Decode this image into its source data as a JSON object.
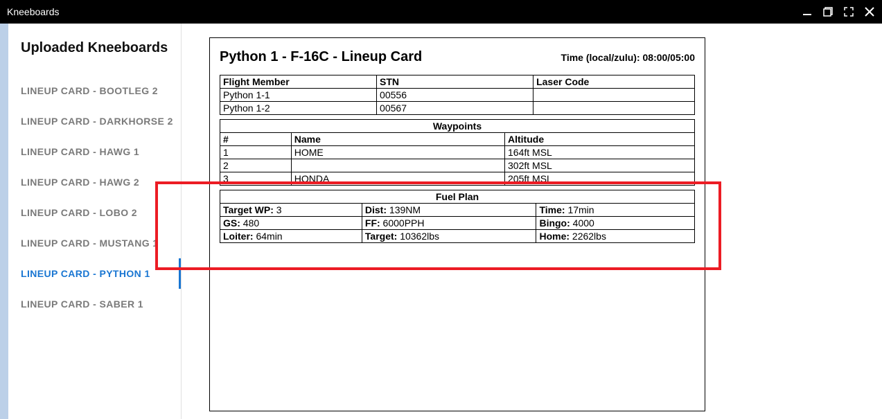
{
  "titlebar": {
    "title": "Kneeboards"
  },
  "sidebar": {
    "title": "Uploaded Kneeboards",
    "items": [
      {
        "label": "LINEUP CARD - BOOTLEG 2"
      },
      {
        "label": "LINEUP CARD - DARKHORSE 2"
      },
      {
        "label": "LINEUP CARD - HAWG 1"
      },
      {
        "label": "LINEUP CARD - HAWG 2"
      },
      {
        "label": "LINEUP CARD - LOBO 2"
      },
      {
        "label": "LINEUP CARD - MUSTANG 1"
      },
      {
        "label": "LINEUP CARD - PYTHON 1"
      },
      {
        "label": "LINEUP CARD - SABER 1"
      }
    ],
    "active_index": 6
  },
  "card": {
    "title": "Python 1 - F-16C - Lineup Card",
    "time_label": "Time (local/zulu): 08:00/05:00",
    "flight_table": {
      "headers": [
        "Flight Member",
        "STN",
        "Laser Code"
      ],
      "rows": [
        {
          "member": "Python 1-1",
          "stn": "00556",
          "laser": ""
        },
        {
          "member": "Python 1-2",
          "stn": "00567",
          "laser": ""
        }
      ]
    },
    "waypoints": {
      "section": "Waypoints",
      "headers": [
        "#",
        "Name",
        "Altitude"
      ],
      "rows": [
        {
          "num": "1",
          "name": "HOME",
          "alt": "164ft MSL"
        },
        {
          "num": "2",
          "name": "",
          "alt": "302ft MSL"
        },
        {
          "num": "3",
          "name": "HONDA",
          "alt": "205ft MSL"
        }
      ]
    },
    "fuel": {
      "section": "Fuel Plan",
      "rows": [
        [
          {
            "label": "Target WP:",
            "value": "3"
          },
          {
            "label": "Dist:",
            "value": "139NM"
          },
          {
            "label": "Time:",
            "value": "17min"
          }
        ],
        [
          {
            "label": "GS:",
            "value": "480"
          },
          {
            "label": "FF:",
            "value": "6000PPH"
          },
          {
            "label": "Bingo:",
            "value": "4000"
          }
        ],
        [
          {
            "label": "Loiter:",
            "value": "64min"
          },
          {
            "label": "Target:",
            "value": "10362lbs"
          },
          {
            "label": "Home:",
            "value": "2262lbs"
          }
        ]
      ]
    }
  }
}
